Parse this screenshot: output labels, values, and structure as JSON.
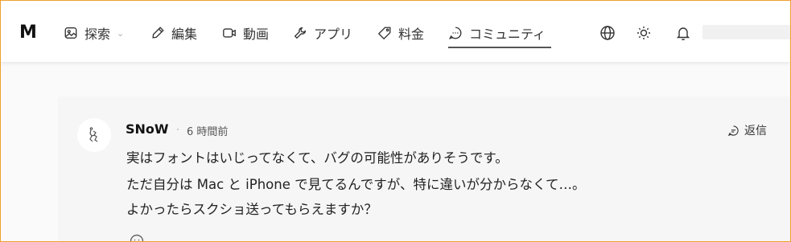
{
  "brand": {
    "logo": "M"
  },
  "nav": [
    {
      "key": "explore",
      "label": "探索",
      "icon": "image-icon",
      "has_caret": true,
      "caret": "⌄"
    },
    {
      "key": "edit",
      "label": "編集",
      "icon": "pen-icon"
    },
    {
      "key": "video",
      "label": "動画",
      "icon": "video-icon"
    },
    {
      "key": "apps",
      "label": "アプリ",
      "icon": "wrench-icon"
    },
    {
      "key": "pricing",
      "label": "料金",
      "icon": "tag-icon"
    },
    {
      "key": "community",
      "label": "コミュニティ",
      "icon": "chat-icon",
      "active": true
    }
  ],
  "header_icons": [
    "globe-icon",
    "sun-icon",
    "bell-icon"
  ],
  "comment": {
    "author": "SNoW",
    "time": "6 時間前",
    "reply_label": "返信",
    "lines": [
      "実はフォントはいじってなくて、バグの可能性がありそうです。",
      "ただ自分は Mac と iPhone で見てるんですが、特に違いが分からなくて…。",
      "よかったらスクショ送ってもらえますか？"
    ]
  },
  "colors": {
    "frame_border": "#f0a030",
    "card_bg": "#f6f6f6",
    "active_underline": "#555555"
  }
}
